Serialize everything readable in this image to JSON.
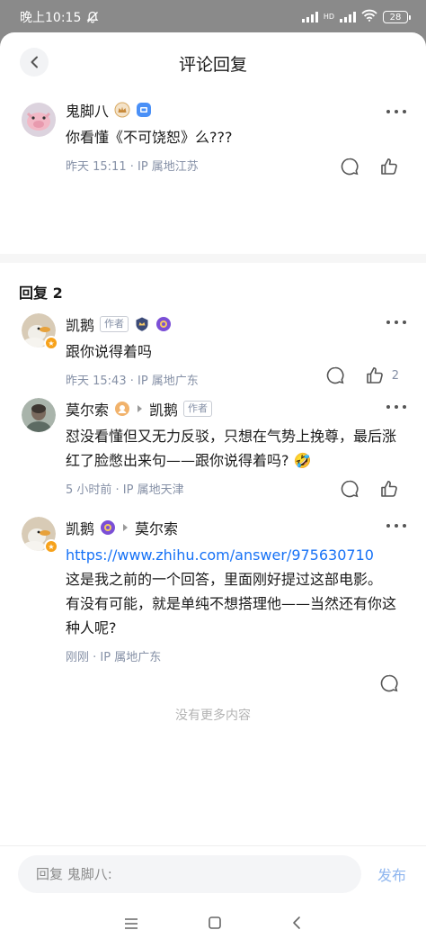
{
  "status_bar": {
    "time": "晚上10:15",
    "network": "HD",
    "battery": "28"
  },
  "header": {
    "title": "评论回复"
  },
  "root_comment": {
    "author": "鬼脚八",
    "text": "你看懂《不可饶恕》么???",
    "meta": "昨天 15:11 · IP 属地江苏"
  },
  "replies_title": "回复 2",
  "replies": [
    {
      "author": "凯鹅",
      "author_tag": "作者",
      "text": "跟你说得着吗",
      "meta": "昨天 15:43 · IP 属地广东",
      "likes": "2"
    },
    {
      "author": "莫尔索",
      "reply_to": "凯鹅",
      "reply_to_tag": "作者",
      "text": "怼没看懂但又无力反驳，只想在气势上挽尊，最后涨红了脸憋出来句——跟你说得着吗? 🤣",
      "meta": "5 小时前 · IP 属地天津"
    },
    {
      "author": "凯鹅",
      "reply_to": "莫尔索",
      "link": "https://www.zhihu.com/answer/975630710",
      "text_1": "这是我之前的一个回答，里面刚好提过这部电影。",
      "text_2": "有没有可能，就是单纯不想搭理他——当然还有你这种人呢?",
      "meta": "刚刚 · IP 属地广东"
    }
  ],
  "no_more": "没有更多内容",
  "reply_bar": {
    "placeholder": "回复 鬼脚八:",
    "send_label": "发布"
  },
  "colors": {
    "link": "#1772f6",
    "meta": "#8590a6",
    "send_disabled": "#8fb6ef",
    "badge_orange": "#f7a21b"
  }
}
